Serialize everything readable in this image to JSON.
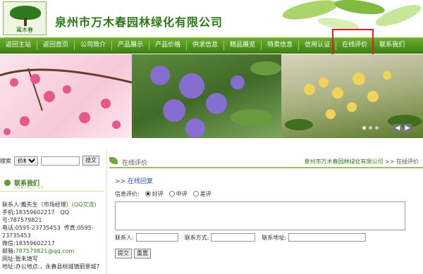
{
  "header": {
    "logo_text": "萬木春",
    "company": "泉州市万木春园林绿化有限公司"
  },
  "nav": [
    "返回主站",
    "返回首页",
    "公司简介",
    "产品展示",
    "产品价格",
    "供求信息",
    "精品展览",
    "特卖信息",
    "信用认证",
    "在线评价",
    "联系我们"
  ],
  "search": {
    "label": "搜索",
    "select_value": "价格",
    "button": "搜文"
  },
  "contact": {
    "title": "联系我们",
    "subtitle": "CONTACT US",
    "person": "联系人:戴先生（市场经理）",
    "qq_link": "(QQ交流)",
    "mobile": "手机:18359602217",
    "qq_label": "QQ",
    "qq_label2": "号:787579821",
    "tel": "电话:0595-23735453",
    "fax": "传真:0595-",
    "fax2": "23735453",
    "wechat": "微信:18359602217",
    "email_label": "邮箱:",
    "email": "787579821@qq.com",
    "website": "网址:暂未填写",
    "office": "地址:办公地点:，永春县桃城镇丽景城7"
  },
  "crumb": {
    "title": "在线评价",
    "home": "泉州市万木春园林绿化有限公司",
    "sep": ">>",
    "current": "在线评价"
  },
  "form": {
    "heading": ">> 在线回复",
    "rating_label": "信息评价:",
    "good": "好评",
    "mid": "中评",
    "bad": "差评",
    "contact_person": "联系人:",
    "contact_way": "联系方式:",
    "contact_addr": "联系地址:",
    "submit": "提交",
    "reset": "重置"
  },
  "colors": {
    "brand": "#2d7a17",
    "nav_green": "#4f961e",
    "highlight": "#e02020"
  }
}
